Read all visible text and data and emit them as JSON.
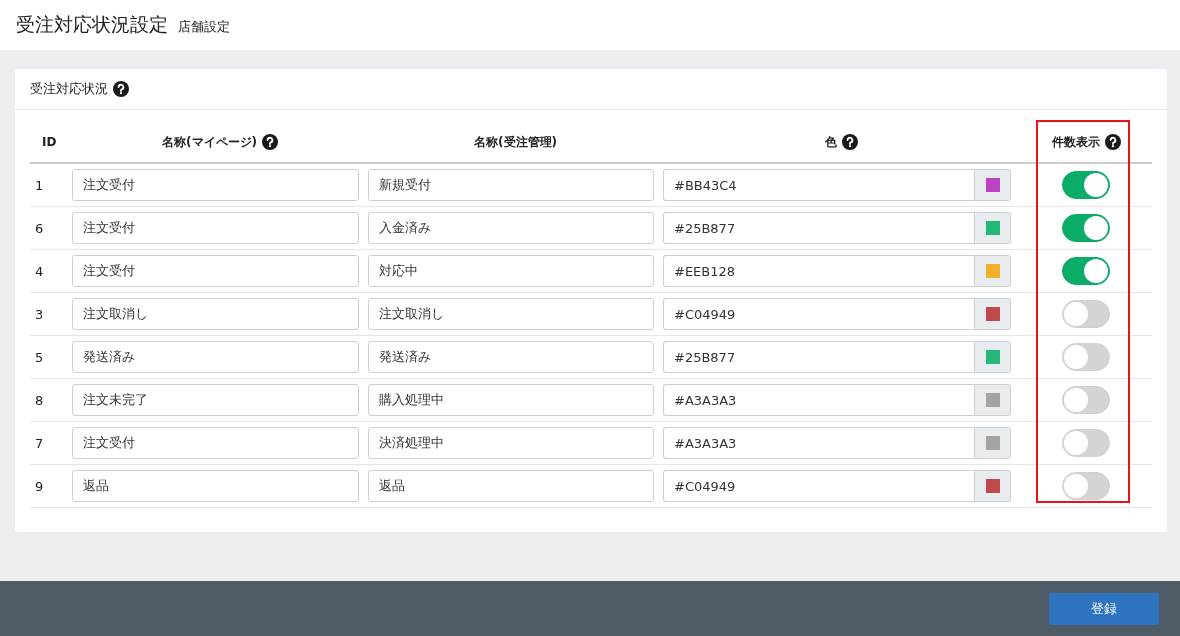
{
  "page": {
    "title": "受注対応状況設定",
    "subtitle": "店舗設定"
  },
  "panel": {
    "title": "受注対応状況"
  },
  "table": {
    "columns": [
      {
        "label": "ID",
        "help": false
      },
      {
        "label": "名称(マイページ)",
        "help": true
      },
      {
        "label": "名称(受注管理)",
        "help": false
      },
      {
        "label": "色",
        "help": true
      },
      {
        "label": "件数表示",
        "help": true
      }
    ],
    "rows": [
      {
        "id": "1",
        "mypage_name": "注文受付",
        "admin_name": "新規受付",
        "color_value": "#BB43C4",
        "color": "#bb43c4",
        "show_count": true
      },
      {
        "id": "6",
        "mypage_name": "注文受付",
        "admin_name": "入金済み",
        "color_value": "#25B877",
        "color": "#25b877",
        "show_count": true
      },
      {
        "id": "4",
        "mypage_name": "注文受付",
        "admin_name": "対応中",
        "color_value": "#EEB128",
        "color": "#eeb128",
        "show_count": true
      },
      {
        "id": "3",
        "mypage_name": "注文取消し",
        "admin_name": "注文取消し",
        "color_value": "#C04949",
        "color": "#c04949",
        "show_count": false
      },
      {
        "id": "5",
        "mypage_name": "発送済み",
        "admin_name": "発送済み",
        "color_value": "#25B877",
        "color": "#25b877",
        "show_count": false
      },
      {
        "id": "8",
        "mypage_name": "注文未完了",
        "admin_name": "購入処理中",
        "color_value": "#A3A3A3",
        "color": "#a3a3a3",
        "show_count": false
      },
      {
        "id": "7",
        "mypage_name": "注文受付",
        "admin_name": "決済処理中",
        "color_value": "#A3A3A3",
        "color": "#a3a3a3",
        "show_count": false
      },
      {
        "id": "9",
        "mypage_name": "返品",
        "admin_name": "返品",
        "color_value": "#C04949",
        "color": "#c04949",
        "show_count": false
      }
    ]
  },
  "footer": {
    "submit_button": "登録"
  }
}
